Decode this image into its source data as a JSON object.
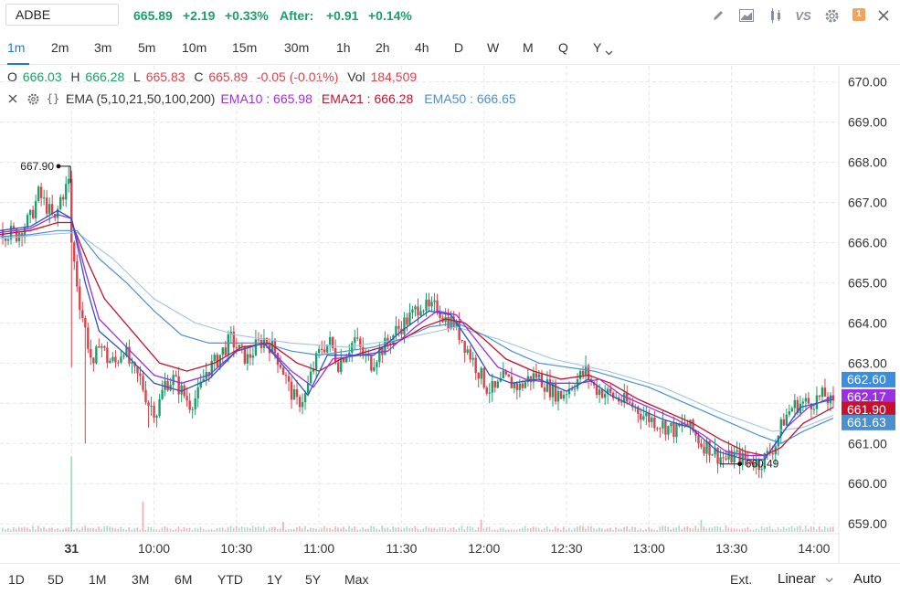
{
  "symbol": "ADBE",
  "quote": {
    "price": "665.89",
    "change": "+2.19",
    "change_pct": "+0.33%",
    "after_label": "After:",
    "after_change": "+0.91",
    "after_pct": "+0.14%"
  },
  "toolbar": {
    "icons": [
      "pencil-icon",
      "area-chart-icon",
      "candlestick-icon",
      "compare-icon",
      "settings-icon",
      "alert-icon",
      "close-icon"
    ],
    "compare_label": "VS",
    "alert_count": "1"
  },
  "intervals": [
    "1m",
    "2m",
    "3m",
    "5m",
    "10m",
    "15m",
    "30m",
    "1h",
    "2h",
    "4h",
    "D",
    "W",
    "M",
    "Q",
    "Y"
  ],
  "active_interval": "1m",
  "ohlc": {
    "o_label": "O",
    "o": "666.03",
    "h_label": "H",
    "h": "666.28",
    "l_label": "L",
    "l": "665.83",
    "c_label": "C",
    "c": "665.89",
    "chg": "-0.05 (-0.01%)",
    "vol_label": "Vol",
    "vol": "184,509"
  },
  "ema": {
    "label": "EMA (5,10,21,50,100,200)",
    "ema10": "EMA10 : 665.98",
    "ema21": "EMA21 : 666.28",
    "ema50": "EMA50 : 666.65"
  },
  "colors": {
    "up": "#1aa06c",
    "down": "#e0404a",
    "ema5": "#2a54c8",
    "ema10": "#9b30e0",
    "ema21": "#c8102e",
    "ema50": "#4a90d0",
    "accent": "#1a7bd8"
  },
  "chart_data": {
    "type": "candlestick",
    "x_tick_labels": [
      "31",
      "10:00",
      "10:30",
      "11:00",
      "11:30",
      "12:00",
      "12:30",
      "13:00",
      "13:30",
      "14:00"
    ],
    "x_tick_times_min": [
      0,
      30,
      60,
      90,
      120,
      150,
      180,
      210,
      240,
      270
    ],
    "y_tick_labels": [
      "670.00",
      "669.00",
      "668.00",
      "667.00",
      "666.00",
      "665.00",
      "664.00",
      "663.00",
      "662.00",
      "661.00",
      "660.00",
      "659.00"
    ],
    "ylim": [
      658.8,
      670.4
    ],
    "xlim_min": [
      -26,
      279
    ],
    "annotations": [
      {
        "label": "667.90",
        "t": -1,
        "value": 667.9
      },
      {
        "label": "660.49",
        "t": 243,
        "value": 660.49
      }
    ],
    "price_tags": [
      {
        "label": "662.60",
        "value": 662.6,
        "color": "#3a8ee0"
      },
      {
        "label": "662.17",
        "value": 662.17,
        "color": "#9b30e0"
      },
      {
        "label": "661.90",
        "value": 661.9,
        "color": "#c8102e"
      },
      {
        "label": "661.63",
        "value": 661.63,
        "color": "#4a90d0"
      }
    ],
    "close_path": [
      [
        -26,
        666.3
      ],
      [
        -20,
        666.2
      ],
      [
        -15,
        666.6
      ],
      [
        -12,
        667.2
      ],
      [
        -9,
        666.9
      ],
      [
        -6,
        666.5
      ],
      [
        -4,
        667.1
      ],
      [
        -1,
        667.5
      ],
      [
        0,
        666.0
      ],
      [
        3,
        664.5
      ],
      [
        6,
        663.5
      ],
      [
        8,
        662.8
      ],
      [
        10,
        663.6
      ],
      [
        13,
        663.1
      ],
      [
        16,
        663.0
      ],
      [
        19,
        663.4
      ],
      [
        22,
        662.8
      ],
      [
        25,
        662.6
      ],
      [
        28,
        662.0
      ],
      [
        31,
        661.8
      ],
      [
        34,
        662.5
      ],
      [
        37,
        662.6
      ],
      [
        40,
        662.3
      ],
      [
        43,
        662.0
      ],
      [
        46,
        662.2
      ],
      [
        49,
        662.8
      ],
      [
        52,
        663.0
      ],
      [
        55,
        663.3
      ],
      [
        58,
        663.6
      ],
      [
        61,
        663.3
      ],
      [
        64,
        663.1
      ],
      [
        67,
        663.4
      ],
      [
        70,
        663.6
      ],
      [
        73,
        663.4
      ],
      [
        76,
        663.0
      ],
      [
        79,
        662.4
      ],
      [
        82,
        662.0
      ],
      [
        85,
        662.2
      ],
      [
        88,
        662.9
      ],
      [
        91,
        663.4
      ],
      [
        94,
        663.5
      ],
      [
        97,
        663.0
      ],
      [
        100,
        663.3
      ],
      [
        103,
        663.6
      ],
      [
        106,
        663.2
      ],
      [
        109,
        663.0
      ],
      [
        112,
        663.3
      ],
      [
        115,
        663.5
      ],
      [
        118,
        663.8
      ],
      [
        121,
        664.0
      ],
      [
        124,
        664.2
      ],
      [
        127,
        664.5
      ],
      [
        130,
        664.3
      ],
      [
        133,
        664.4
      ],
      [
        136,
        664.1
      ],
      [
        139,
        664.0
      ],
      [
        142,
        663.6
      ],
      [
        145,
        663.2
      ],
      [
        148,
        662.8
      ],
      [
        151,
        662.4
      ],
      [
        154,
        662.3
      ],
      [
        157,
        662.6
      ],
      [
        160,
        662.5
      ],
      [
        163,
        662.4
      ],
      [
        166,
        662.6
      ],
      [
        169,
        662.7
      ],
      [
        172,
        662.5
      ],
      [
        175,
        662.3
      ],
      [
        178,
        662.2
      ],
      [
        181,
        662.4
      ],
      [
        184,
        662.6
      ],
      [
        187,
        662.8
      ],
      [
        190,
        662.4
      ],
      [
        193,
        662.3
      ],
      [
        196,
        662.2
      ],
      [
        199,
        662.1
      ],
      [
        202,
        662.0
      ],
      [
        205,
        661.9
      ],
      [
        208,
        661.7
      ],
      [
        211,
        661.6
      ],
      [
        214,
        661.5
      ],
      [
        217,
        661.4
      ],
      [
        220,
        661.3
      ],
      [
        223,
        661.5
      ],
      [
        226,
        661.3
      ],
      [
        229,
        661.0
      ],
      [
        232,
        660.9
      ],
      [
        235,
        660.7
      ],
      [
        238,
        660.6
      ],
      [
        241,
        660.7
      ],
      [
        244,
        660.6
      ],
      [
        247,
        660.6
      ],
      [
        250,
        660.5
      ],
      [
        253,
        660.7
      ],
      [
        256,
        661.0
      ],
      [
        259,
        661.6
      ],
      [
        262,
        661.9
      ],
      [
        265,
        662.0
      ],
      [
        268,
        662.0
      ],
      [
        271,
        662.1
      ],
      [
        274,
        662.2
      ],
      [
        277,
        661.9
      ]
    ],
    "ema5_path": [
      [
        -26,
        666.3
      ],
      [
        -15,
        666.4
      ],
      [
        -5,
        666.8
      ],
      [
        0,
        666.6
      ],
      [
        5,
        665.0
      ],
      [
        10,
        663.8
      ],
      [
        20,
        663.2
      ],
      [
        30,
        662.5
      ],
      [
        40,
        662.3
      ],
      [
        50,
        662.6
      ],
      [
        60,
        663.3
      ],
      [
        70,
        663.5
      ],
      [
        80,
        662.7
      ],
      [
        86,
        662.2
      ],
      [
        93,
        663.2
      ],
      [
        100,
        663.2
      ],
      [
        110,
        663.2
      ],
      [
        120,
        663.8
      ],
      [
        130,
        664.3
      ],
      [
        138,
        664.2
      ],
      [
        145,
        663.5
      ],
      [
        152,
        662.7
      ],
      [
        160,
        662.5
      ],
      [
        170,
        662.6
      ],
      [
        180,
        662.3
      ],
      [
        188,
        662.6
      ],
      [
        196,
        662.2
      ],
      [
        205,
        661.9
      ],
      [
        215,
        661.6
      ],
      [
        225,
        661.4
      ],
      [
        235,
        660.8
      ],
      [
        245,
        660.6
      ],
      [
        252,
        660.6
      ],
      [
        258,
        661.2
      ],
      [
        265,
        661.9
      ],
      [
        277,
        662.1
      ]
    ],
    "ema10_path": [
      [
        -26,
        666.25
      ],
      [
        -15,
        666.35
      ],
      [
        -5,
        666.7
      ],
      [
        0,
        666.6
      ],
      [
        5,
        665.3
      ],
      [
        10,
        664.1
      ],
      [
        20,
        663.4
      ],
      [
        30,
        662.7
      ],
      [
        40,
        662.5
      ],
      [
        50,
        662.7
      ],
      [
        60,
        663.3
      ],
      [
        70,
        663.5
      ],
      [
        80,
        662.8
      ],
      [
        88,
        662.4
      ],
      [
        95,
        663.1
      ],
      [
        105,
        663.2
      ],
      [
        115,
        663.3
      ],
      [
        125,
        663.9
      ],
      [
        133,
        664.3
      ],
      [
        140,
        664.2
      ],
      [
        148,
        663.5
      ],
      [
        155,
        662.9
      ],
      [
        165,
        662.6
      ],
      [
        175,
        662.5
      ],
      [
        185,
        662.5
      ],
      [
        192,
        662.6
      ],
      [
        200,
        662.2
      ],
      [
        210,
        661.9
      ],
      [
        220,
        661.6
      ],
      [
        230,
        661.2
      ],
      [
        238,
        660.8
      ],
      [
        246,
        660.7
      ],
      [
        253,
        660.7
      ],
      [
        260,
        661.4
      ],
      [
        268,
        661.9
      ],
      [
        277,
        662.17
      ]
    ],
    "ema21_path": [
      [
        -26,
        666.2
      ],
      [
        -15,
        666.3
      ],
      [
        -5,
        666.5
      ],
      [
        0,
        666.5
      ],
      [
        6,
        665.5
      ],
      [
        12,
        664.6
      ],
      [
        22,
        663.8
      ],
      [
        32,
        663.0
      ],
      [
        42,
        662.8
      ],
      [
        52,
        663.0
      ],
      [
        62,
        663.4
      ],
      [
        72,
        663.5
      ],
      [
        82,
        663.0
      ],
      [
        90,
        662.8
      ],
      [
        98,
        663.1
      ],
      [
        108,
        663.3
      ],
      [
        118,
        663.5
      ],
      [
        128,
        663.9
      ],
      [
        136,
        664.1
      ],
      [
        143,
        664.0
      ],
      [
        150,
        663.6
      ],
      [
        158,
        663.1
      ],
      [
        168,
        662.8
      ],
      [
        178,
        662.6
      ],
      [
        188,
        662.7
      ],
      [
        196,
        662.5
      ],
      [
        206,
        662.1
      ],
      [
        216,
        661.8
      ],
      [
        226,
        661.5
      ],
      [
        236,
        661.1
      ],
      [
        245,
        660.8
      ],
      [
        252,
        660.7
      ],
      [
        258,
        660.9
      ],
      [
        266,
        661.5
      ],
      [
        277,
        661.9
      ]
    ],
    "ema50_path": [
      [
        -26,
        666.15
      ],
      [
        -15,
        666.2
      ],
      [
        -5,
        666.3
      ],
      [
        2,
        666.3
      ],
      [
        10,
        665.6
      ],
      [
        20,
        665.0
      ],
      [
        30,
        664.3
      ],
      [
        40,
        663.7
      ],
      [
        50,
        663.5
      ],
      [
        60,
        663.5
      ],
      [
        70,
        663.5
      ],
      [
        80,
        663.3
      ],
      [
        90,
        663.2
      ],
      [
        100,
        663.3
      ],
      [
        110,
        663.4
      ],
      [
        120,
        663.6
      ],
      [
        130,
        663.9
      ],
      [
        140,
        664.0
      ],
      [
        150,
        663.7
      ],
      [
        160,
        663.3
      ],
      [
        170,
        663.0
      ],
      [
        180,
        662.9
      ],
      [
        190,
        662.8
      ],
      [
        200,
        662.6
      ],
      [
        210,
        662.4
      ],
      [
        220,
        662.1
      ],
      [
        230,
        661.8
      ],
      [
        240,
        661.5
      ],
      [
        250,
        661.2
      ],
      [
        258,
        661.0
      ],
      [
        266,
        661.3
      ],
      [
        277,
        661.63
      ]
    ],
    "ema100_path": [
      [
        -26,
        666.1
      ],
      [
        -10,
        666.2
      ],
      [
        2,
        666.25
      ],
      [
        15,
        665.6
      ],
      [
        30,
        664.6
      ],
      [
        45,
        664.0
      ],
      [
        60,
        663.7
      ],
      [
        80,
        663.5
      ],
      [
        100,
        663.4
      ],
      [
        120,
        663.6
      ],
      [
        140,
        663.9
      ],
      [
        155,
        663.6
      ],
      [
        175,
        663.1
      ],
      [
        195,
        662.8
      ],
      [
        215,
        662.4
      ],
      [
        235,
        661.8
      ],
      [
        255,
        661.3
      ],
      [
        266,
        661.4
      ],
      [
        277,
        661.7
      ]
    ],
    "volume_spikes": [
      {
        "t": 0,
        "v": 0.75,
        "up": true
      },
      {
        "t": 26,
        "v": 0.3,
        "up": false
      },
      {
        "t": 77,
        "v": 0.1,
        "up": false
      },
      {
        "t": 149,
        "v": 0.12,
        "up": false
      },
      {
        "t": 229,
        "v": 0.12,
        "up": true
      }
    ]
  },
  "range_tabs": [
    "1D",
    "5D",
    "1M",
    "3M",
    "6M",
    "YTD",
    "1Y",
    "5Y",
    "Max"
  ],
  "bottom": {
    "ext_label": "Ext.",
    "scale_label": "Linear",
    "auto_label": "Auto"
  }
}
